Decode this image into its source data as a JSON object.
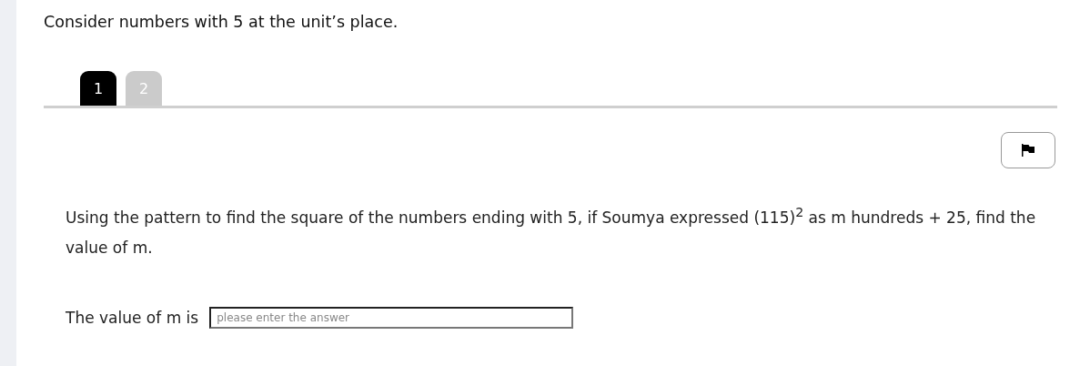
{
  "heading": "Consider numbers with 5 at the unit’s place.",
  "tabs": [
    {
      "label": "1",
      "selected": true
    },
    {
      "label": "2",
      "selected": false
    }
  ],
  "question": "Using the pattern to find the square of the numbers ending with 5, if Soumya expressed (115)$^{2}$ as m hundreds + 25, find the value of m.",
  "answer": {
    "label": "The value of m is",
    "placeholder": "please enter the answer"
  }
}
